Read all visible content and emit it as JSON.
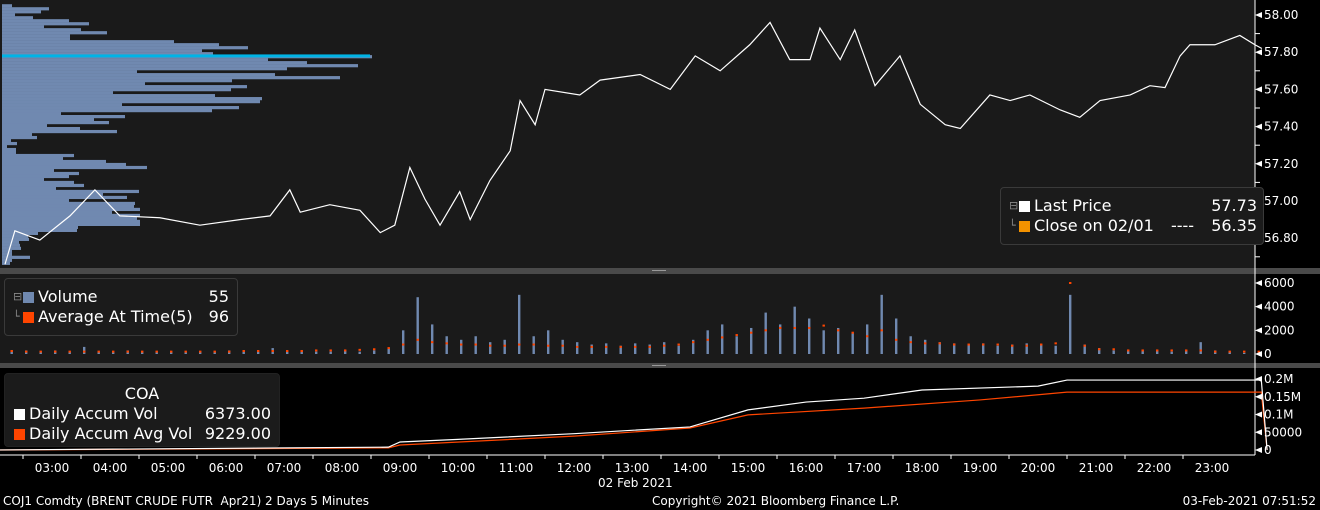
{
  "chart_data": [
    {
      "type": "line",
      "name": "price-panel",
      "ylim": [
        56.64,
        58.06
      ],
      "yticks": [
        "56.80",
        "57.00",
        "57.20",
        "57.40",
        "57.60",
        "57.80",
        "58.00"
      ],
      "series": [
        {
          "name": "Last Price",
          "color": "#ffffff",
          "points": [
            [
              2.19,
              56.66
            ],
            [
              2.36,
              56.84
            ],
            [
              2.79,
              56.79
            ],
            [
              3.31,
              56.92
            ],
            [
              3.74,
              57.06
            ],
            [
              4.17,
              56.92
            ],
            [
              4.86,
              56.91
            ],
            [
              5.55,
              56.87
            ],
            [
              6.24,
              56.9
            ],
            [
              6.76,
              56.92
            ],
            [
              7.1,
              57.06
            ],
            [
              7.28,
              56.94
            ],
            [
              7.79,
              56.98
            ],
            [
              8.31,
              56.95
            ],
            [
              8.66,
              56.83
            ],
            [
              8.91,
              56.87
            ],
            [
              9.17,
              57.18
            ],
            [
              9.43,
              57.01
            ],
            [
              9.69,
              56.87
            ],
            [
              10.03,
              57.05
            ],
            [
              10.21,
              56.9
            ],
            [
              10.55,
              57.11
            ],
            [
              10.9,
              57.27
            ],
            [
              11.07,
              57.54
            ],
            [
              11.33,
              57.41
            ],
            [
              11.5,
              57.6
            ],
            [
              12.1,
              57.57
            ],
            [
              12.45,
              57.65
            ],
            [
              13.14,
              57.68
            ],
            [
              13.66,
              57.6
            ],
            [
              14.09,
              57.78
            ],
            [
              14.52,
              57.7
            ],
            [
              15.03,
              57.84
            ],
            [
              15.38,
              57.96
            ],
            [
              15.72,
              57.76
            ],
            [
              16.07,
              57.76
            ],
            [
              16.24,
              57.93
            ],
            [
              16.59,
              57.76
            ],
            [
              16.84,
              57.92
            ],
            [
              17.19,
              57.62
            ],
            [
              17.62,
              57.78
            ],
            [
              17.97,
              57.52
            ],
            [
              18.4,
              57.41
            ],
            [
              18.66,
              57.39
            ],
            [
              19.17,
              57.57
            ],
            [
              19.52,
              57.54
            ],
            [
              19.86,
              57.57
            ],
            [
              20.38,
              57.49
            ],
            [
              20.72,
              57.45
            ],
            [
              21.07,
              57.54
            ],
            [
              21.59,
              57.57
            ],
            [
              21.93,
              57.62
            ],
            [
              22.19,
              57.61
            ],
            [
              22.45,
              57.78
            ],
            [
              22.62,
              57.84
            ],
            [
              23.05,
              57.84
            ],
            [
              23.48,
              57.89
            ],
            [
              23.74,
              57.84
            ],
            [
              23.86,
              57.82
            ]
          ]
        }
      ],
      "volume_profile": {
        "price_start": 58.05,
        "price_step": -0.0161,
        "highlight_price": 57.78,
        "highlight_color": "#00b4e6",
        "values": [
          10,
          47,
          39,
          13,
          31,
          67,
          87,
          42,
          79,
          105,
          68,
          68,
          172,
          217,
          246,
          200,
          211,
          370,
          266,
          305,
          356,
          285,
          135,
          273,
          338,
          230,
          143,
          245,
          229,
          111,
          213,
          260,
          258,
          120,
          237,
          210,
          59,
          123,
          92,
          107,
          45,
          78,
          115,
          30,
          35,
          9,
          15,
          5,
          14,
          14,
          72,
          61,
          104,
          124,
          145,
          52,
          77,
          67,
          42,
          72,
          82,
          54,
          137,
          101,
          125,
          67,
          133,
          132,
          138,
          110,
          138,
          135,
          138,
          138,
          76,
          75,
          36,
          26,
          27,
          17,
          18,
          19,
          10,
          10,
          28,
          10,
          8
        ]
      },
      "legend": {
        "last_price_label": "Last Price",
        "last_price_value": "57.73",
        "close_label": "Close on 02/01",
        "close_dashes": "----",
        "close_value": "56.35",
        "last_color": "#ffffff",
        "close_color": "#f39200"
      }
    },
    {
      "type": "bar",
      "name": "volume-panel",
      "ylim": [
        0,
        6000
      ],
      "yticks": [
        "0",
        "2000",
        "4000",
        "6000"
      ],
      "x_start_hour": 2,
      "x_step_hours": 0.25,
      "series": [
        {
          "name": "Volume",
          "color": "#7089b0",
          "values": [
            800,
            300,
            300,
            200,
            300,
            200,
            600,
            200,
            200,
            300,
            200,
            200,
            200,
            200,
            200,
            200,
            300,
            300,
            200,
            500,
            200,
            300,
            200,
            200,
            300,
            200,
            300,
            500,
            2000,
            4800,
            2500,
            1500,
            1200,
            1500,
            1000,
            1200,
            5000,
            1500,
            2000,
            1200,
            1000,
            800,
            900,
            700,
            900,
            800,
            1000,
            700,
            1200,
            2000,
            2500,
            1500,
            2200,
            3500,
            2500,
            4000,
            3000,
            2000,
            2200,
            1800,
            2500,
            5000,
            3000,
            1500,
            1200,
            1000,
            900,
            800,
            900,
            700,
            800,
            900,
            800,
            700,
            5000,
            800,
            500,
            300,
            300,
            300,
            300,
            200,
            300,
            1000,
            300,
            200,
            100,
            100
          ]
        },
        {
          "name": "Average At Time(5)",
          "color": "#ff4500",
          "values": [
            200,
            250,
            200,
            200,
            200,
            200,
            200,
            200,
            200,
            200,
            200,
            200,
            200,
            200,
            200,
            200,
            200,
            250,
            250,
            250,
            250,
            250,
            300,
            300,
            300,
            350,
            400,
            500,
            800,
            1200,
            1000,
            900,
            800,
            800,
            700,
            700,
            800,
            800,
            700,
            700,
            600,
            600,
            600,
            600,
            600,
            600,
            700,
            800,
            1000,
            1200,
            1400,
            1600,
            1800,
            2000,
            2200,
            2200,
            2200,
            2400,
            2000,
            1800,
            1500,
            2000,
            1200,
            1000,
            900,
            900,
            800,
            800,
            800,
            800,
            700,
            700,
            800,
            900,
            6000,
            700,
            400,
            400,
            300,
            300,
            300,
            300,
            300,
            300,
            200,
            200,
            200,
            200
          ]
        }
      ],
      "legend": {
        "volume_label": "Volume",
        "volume_value": "55",
        "avg_label": "Average At Time(5)",
        "avg_value": "96"
      }
    },
    {
      "type": "line",
      "name": "accum-panel",
      "ylim": [
        0,
        200000
      ],
      "yticks": [
        "0",
        "50000",
        "0.1M",
        "0.15M",
        "0.2M"
      ],
      "series": [
        {
          "name": "Daily Accum Vol",
          "color": "#ffffff",
          "points": [
            [
              2.0,
              0
            ],
            [
              8.8,
              8000
            ],
            [
              9.0,
              22500
            ],
            [
              10.0,
              30000
            ],
            [
              12.0,
              46000
            ],
            [
              14.0,
              65000
            ],
            [
              15.0,
              113000
            ],
            [
              16.0,
              135000
            ],
            [
              17.0,
              146000
            ],
            [
              18.0,
              169000
            ],
            [
              20.0,
              180000
            ],
            [
              20.5,
              197000
            ],
            [
              23.85,
              197000
            ],
            [
              23.95,
              0
            ]
          ]
        },
        {
          "name": "Daily Accum Avg Vol",
          "color": "#ff4500",
          "points": [
            [
              2.0,
              0
            ],
            [
              8.8,
              6000
            ],
            [
              9.0,
              14000
            ],
            [
              12.0,
              39000
            ],
            [
              14.0,
              62000
            ],
            [
              15.0,
              99000
            ],
            [
              17.0,
              118000
            ],
            [
              19.0,
              141000
            ],
            [
              20.5,
              163000
            ],
            [
              23.85,
              163000
            ],
            [
              23.95,
              0
            ]
          ]
        }
      ],
      "legend": {
        "title": "COA",
        "accum_label": "Daily Accum Vol",
        "accum_value": "6373.00",
        "avg_label": "Daily Accum Avg Vol",
        "avg_value": "9229.00"
      }
    }
  ],
  "x_axis": {
    "ticks": [
      "03:00",
      "04:00",
      "05:00",
      "06:00",
      "07:00",
      "08:00",
      "09:00",
      "10:00",
      "11:00",
      "12:00",
      "13:00",
      "14:00",
      "15:00",
      "16:00",
      "17:00",
      "18:00",
      "19:00",
      "20:00",
      "21:00",
      "22:00",
      "23:00"
    ],
    "date_label": "02 Feb 2021"
  },
  "footer": {
    "security": "COJ1 Comdty (BRENT CRUDE FUTR  Apr21) 2 Days 5 Minutes",
    "copyright": "Copyright© 2021 Bloomberg Finance L.P.",
    "timestamp": "03-Feb-2021 07:51:52"
  }
}
